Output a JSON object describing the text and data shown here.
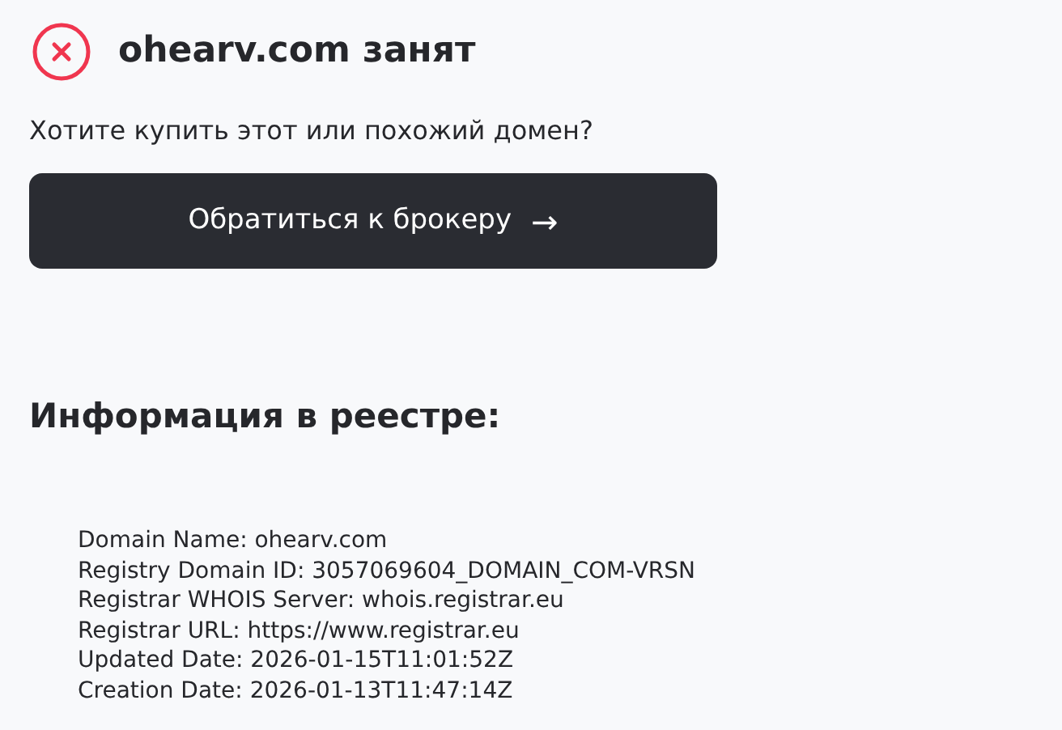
{
  "status": {
    "title": "ohearv.com занят",
    "question": "Хотите купить этот или похожий домен?"
  },
  "broker_button": {
    "label": "Обратиться к брокеру",
    "arrow": "→"
  },
  "registry": {
    "heading": "Информация в реестре:",
    "lines": [
      "Domain Name: ohearv.com",
      "Registry Domain ID: 3057069604_DOMAIN_COM-VRSN",
      "Registrar WHOIS Server: whois.registrar.eu",
      "Registrar URL: https://www.registrar.eu",
      "Updated Date: 2026-01-15T11:01:52Z",
      "Creation Date: 2026-01-13T11:47:14Z"
    ]
  }
}
